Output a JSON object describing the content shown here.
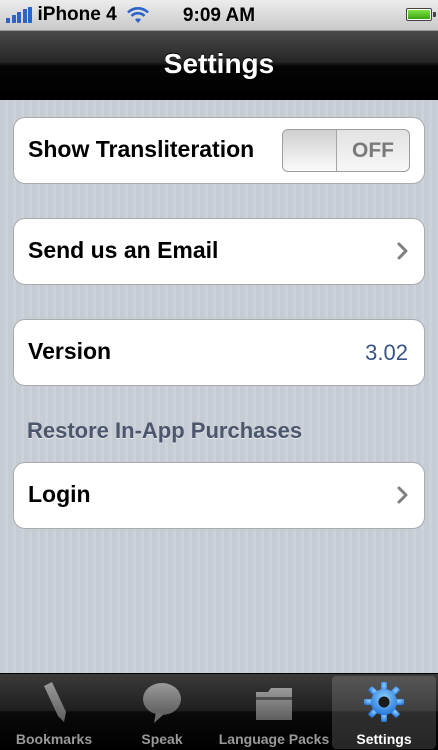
{
  "status_bar": {
    "carrier": "iPhone 4",
    "time": "9:09 AM"
  },
  "nav": {
    "title": "Settings"
  },
  "settings": {
    "transliteration": {
      "label": "Show Transliteration",
      "toggle_state": "OFF"
    },
    "email": {
      "label": "Send us an Email"
    },
    "version": {
      "label": "Version",
      "value": "3.02"
    },
    "restore_header": "Restore In-App Purchases",
    "login": {
      "label": "Login"
    }
  },
  "tab_bar": {
    "tabs": [
      {
        "label": "Bookmarks",
        "icon": "bookmark-pen-icon"
      },
      {
        "label": "Speak",
        "icon": "speech-bubble-icon"
      },
      {
        "label": "Language Packs",
        "icon": "folder-icon"
      },
      {
        "label": "Settings",
        "icon": "gear-icon",
        "selected": true
      }
    ]
  },
  "colors": {
    "value_text": "#385487",
    "section_header": "#4c566c",
    "selected_tab_icon": "#2f8fe6"
  }
}
